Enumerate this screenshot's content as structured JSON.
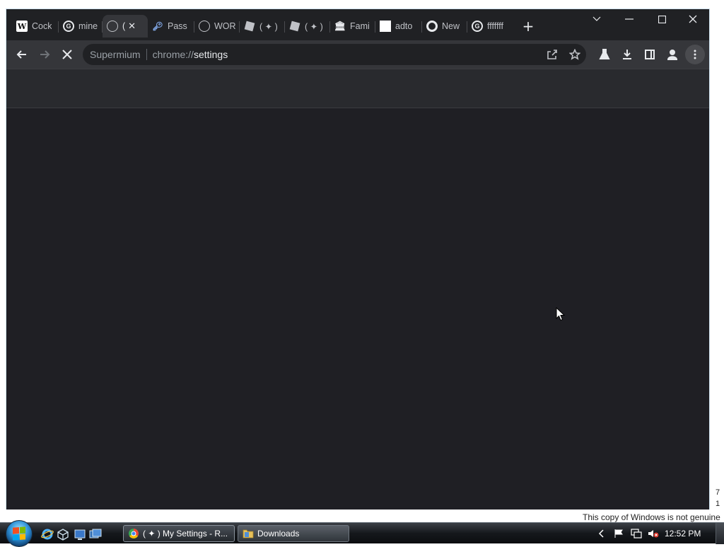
{
  "browser": {
    "tabs": [
      {
        "title": "Cock",
        "icon": "wikipedia-icon"
      },
      {
        "title": "mine",
        "icon": "google-icon"
      },
      {
        "title": "(",
        "icon": "globe-icon",
        "active": true
      },
      {
        "title": "Pass",
        "icon": "key-icon"
      },
      {
        "title": "WOR",
        "icon": "globe-icon"
      },
      {
        "title": "( ✦ )",
        "icon": "roblox-icon"
      },
      {
        "title": "( ✦ )",
        "icon": "roblox-icon"
      },
      {
        "title": "Fami",
        "icon": "bank-icon"
      },
      {
        "title": "adto",
        "icon": "blank-page-icon"
      },
      {
        "title": "New",
        "icon": "chrome-icon"
      },
      {
        "title": "fffffff",
        "icon": "google-icon"
      }
    ],
    "omnibox": {
      "chip": "Supermium",
      "url_scheme": "chrome://",
      "url_host": "settings"
    },
    "colors": {
      "frame": "#202124",
      "toolbar": "#35363a",
      "page_header": "#292a2e",
      "page_bg": "#1f1f24",
      "accent": "#8ab4f8"
    }
  },
  "taskbar": {
    "windows": [
      {
        "label": "( ✦ ) My Settings - R...",
        "icon": "chrome-icon",
        "active": true
      },
      {
        "label": "Downloads",
        "icon": "folder-icon",
        "active": false
      }
    ],
    "clock": "12:52 PM"
  },
  "desktop": {
    "watermark": "This copy of Windows is not genuine",
    "build_line1": "7",
    "build_line2": "1"
  }
}
